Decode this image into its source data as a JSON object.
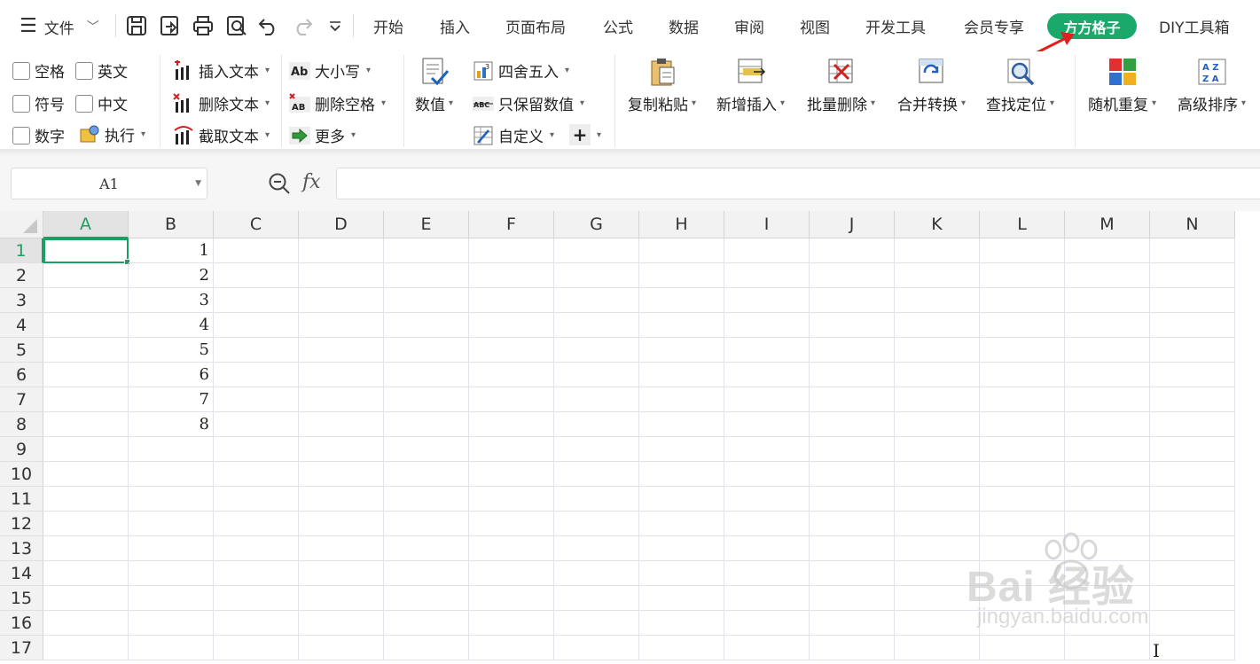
{
  "menu": {
    "file_label": "文件",
    "tabs": [
      "开始",
      "插入",
      "页面布局",
      "公式",
      "数据",
      "审阅",
      "视图",
      "开发工具",
      "会员专享"
    ],
    "active_tab": "方方格子",
    "last_tab": "DIY工具箱"
  },
  "ribbon": {
    "checkboxes": [
      "空格",
      "英文",
      "符号",
      "中文",
      "数字"
    ],
    "execute": "执行",
    "text_ops": [
      "插入文本",
      "删除文本",
      "截取文本"
    ],
    "case_ops": [
      "大小写",
      "删除空格",
      "更多"
    ],
    "value_btn": "数值",
    "round_ops": [
      "四舍五入",
      "只保留数值",
      "自定义"
    ],
    "big_buttons": [
      "复制粘贴",
      "新增插入",
      "批量删除",
      "合并转换",
      "查找定位",
      "随机重复",
      "高级排序"
    ]
  },
  "formula_bar": {
    "name_box": "A1",
    "fx": "fx",
    "formula": ""
  },
  "sheet": {
    "columns": [
      "A",
      "B",
      "C",
      "D",
      "E",
      "F",
      "G",
      "H",
      "I",
      "J",
      "K",
      "L",
      "M",
      "N"
    ],
    "rows": [
      "1",
      "2",
      "3",
      "4",
      "5",
      "6",
      "7",
      "8",
      "9",
      "10",
      "11",
      "12",
      "13",
      "14",
      "15",
      "16",
      "17"
    ],
    "column_b_values": [
      "1",
      "2",
      "3",
      "4",
      "5",
      "6",
      "7",
      "8"
    ],
    "selected_cell": "A1"
  },
  "watermark": {
    "main": "Bai 经验",
    "sub": "jingyan.baidu.com"
  },
  "colors": {
    "accent": "#1aa86b",
    "arrow": "#e02020"
  }
}
